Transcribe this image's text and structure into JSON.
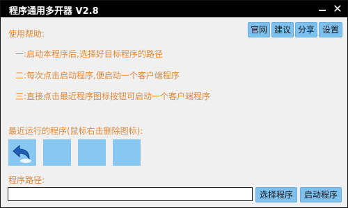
{
  "window": {
    "title": "程序通用多开器 V2.8",
    "minimize_icon": "minimize-icon",
    "close_symbol": "✕"
  },
  "top_buttons": {
    "official": "官网",
    "suggest": "建议",
    "share": "分享",
    "settings": "设置"
  },
  "help": {
    "title": "使用帮助:",
    "lines": [
      "一:启动本程序后,选择好目标程序的路径",
      "二:每次点击启动程序,便启动一个客户端程序",
      "三:直接点击最近程序图标按钮可启动一个客户端程序"
    ]
  },
  "recent": {
    "title": "最近运行的程序(鼠标右击删除图标):",
    "slots": [
      {
        "icon": "undo-arrow-icon"
      },
      {
        "icon": "empty"
      },
      {
        "icon": "empty"
      },
      {
        "icon": "empty"
      }
    ]
  },
  "path": {
    "label": "程序路径:",
    "value": ""
  },
  "bottom_buttons": {
    "select": "选择程序",
    "launch": "启动程序"
  },
  "colors": {
    "accent_text": "#e08a3a",
    "button_bg": "#7ec0ee",
    "titlebar": "#000000",
    "window_bg": "#f0f0f0"
  }
}
